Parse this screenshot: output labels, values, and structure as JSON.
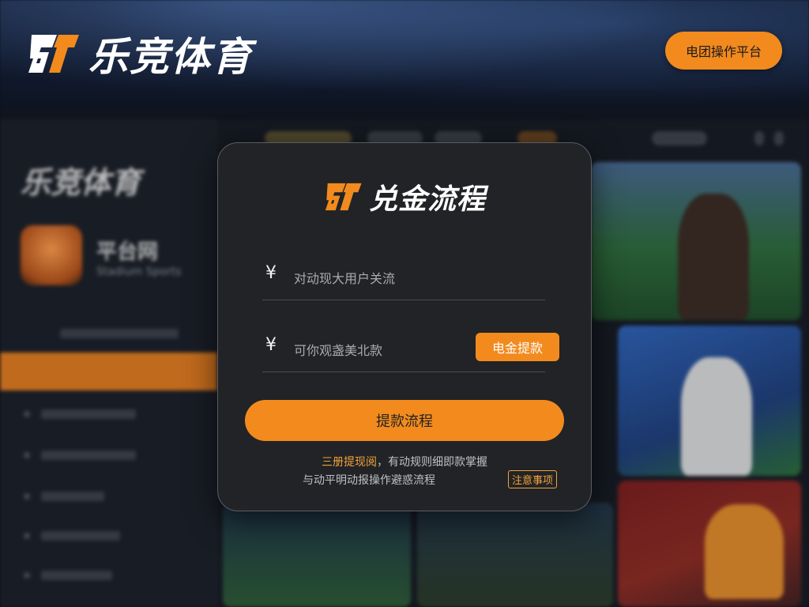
{
  "brand": {
    "name": "乐竞体育",
    "mark_icon": "brand-logo-icon"
  },
  "header": {
    "cta_label": "电团操作平台"
  },
  "background": {
    "side_title": "乐竞体育",
    "side_badge_title": "平台网",
    "side_badge_sub": "Stadium Sports"
  },
  "modal": {
    "title": "兑金流程",
    "fields": [
      {
        "icon": "¥",
        "placeholder": "对动现大用户关流"
      },
      {
        "icon": "¥",
        "placeholder": "可你观盏美北款"
      }
    ],
    "inline_button_label": "电金提款",
    "primary_button_label": "提款流程",
    "note_highlight": "三册提现阅",
    "note_line1_rest": "，有动规则细即款掌握",
    "note_line2": "与动平明动报操作避惑流程",
    "attention_label": "注意事项"
  },
  "colors": {
    "accent": "#f28a1e",
    "modal_bg": "#222326"
  }
}
